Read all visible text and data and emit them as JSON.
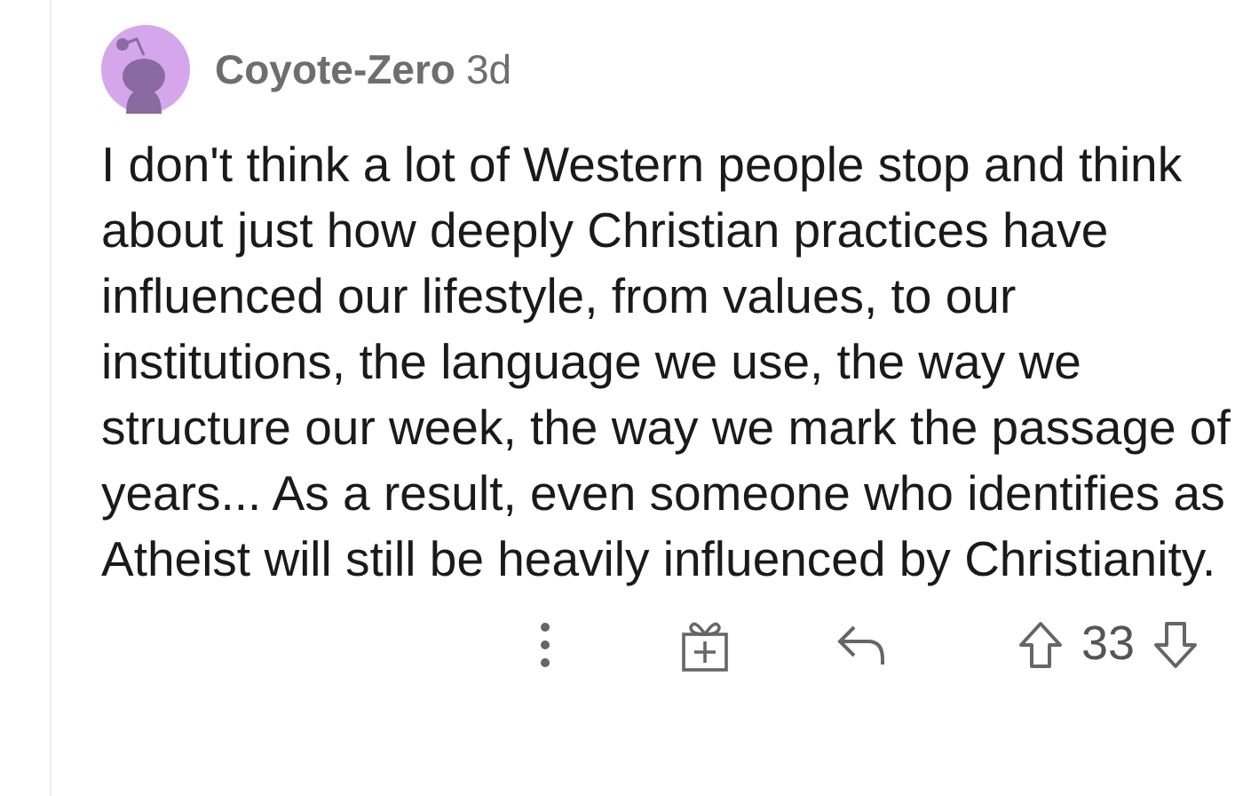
{
  "comment": {
    "username": "Coyote-Zero",
    "age": "3d",
    "body": "I don't think a lot of Western people stop and think about just how deeply Christian practices have influenced our lifestyle, from values, to our institutions, the language we use, the way we structure our week, the way we mark the passage of years... As a result, even someone who identifies as Atheist will still be heavily influenced by Christianity.",
    "score": "33"
  }
}
